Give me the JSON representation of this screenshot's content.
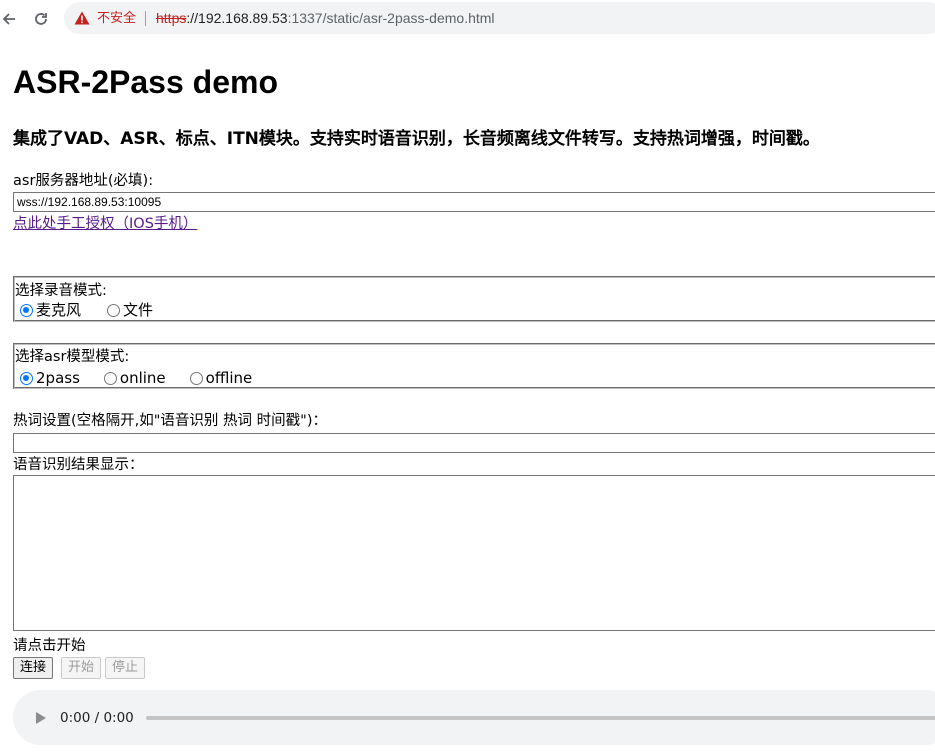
{
  "browser": {
    "back_icon": "arrow-left-icon",
    "reload_icon": "reload-icon",
    "security_icon": "warning-triangle-icon",
    "security_label": "不安全",
    "url_scheme": "https",
    "url_host": "://192.168.89.53",
    "url_path": ":1337/static/asr-2pass-demo.html",
    "warning_color": "#c5221f"
  },
  "page": {
    "title": "ASR-2Pass demo",
    "subtitle": "集成了VAD、ASR、标点、ITN模块。支持实时语音识别，长音频离线文件转写。支持热词增强，时间戳。",
    "server_label": "asr服务器地址(必填):",
    "server_value": "wss://192.168.89.53:10095",
    "auth_link": "点此处手工授权（IOS手机）",
    "record_mode": {
      "legend": "选择录音模式:",
      "options": [
        "麦克风",
        "文件"
      ],
      "selected": "麦克风"
    },
    "asr_mode": {
      "legend": "选择asr模型模式:",
      "options": [
        "2pass",
        "online",
        "offline"
      ],
      "selected": "2pass"
    },
    "hotword_label": "热词设置(空格隔开,如\"语音识别 热词 时间戳\")：",
    "hotword_value": "",
    "result_label": "语音识别结果显示：",
    "result_value": "",
    "status_text": "请点击开始",
    "buttons": {
      "connect": "连接",
      "start": "开始",
      "stop": "停止"
    },
    "audio": {
      "play_icon": "play-icon",
      "time": "0:00 / 0:00"
    }
  }
}
